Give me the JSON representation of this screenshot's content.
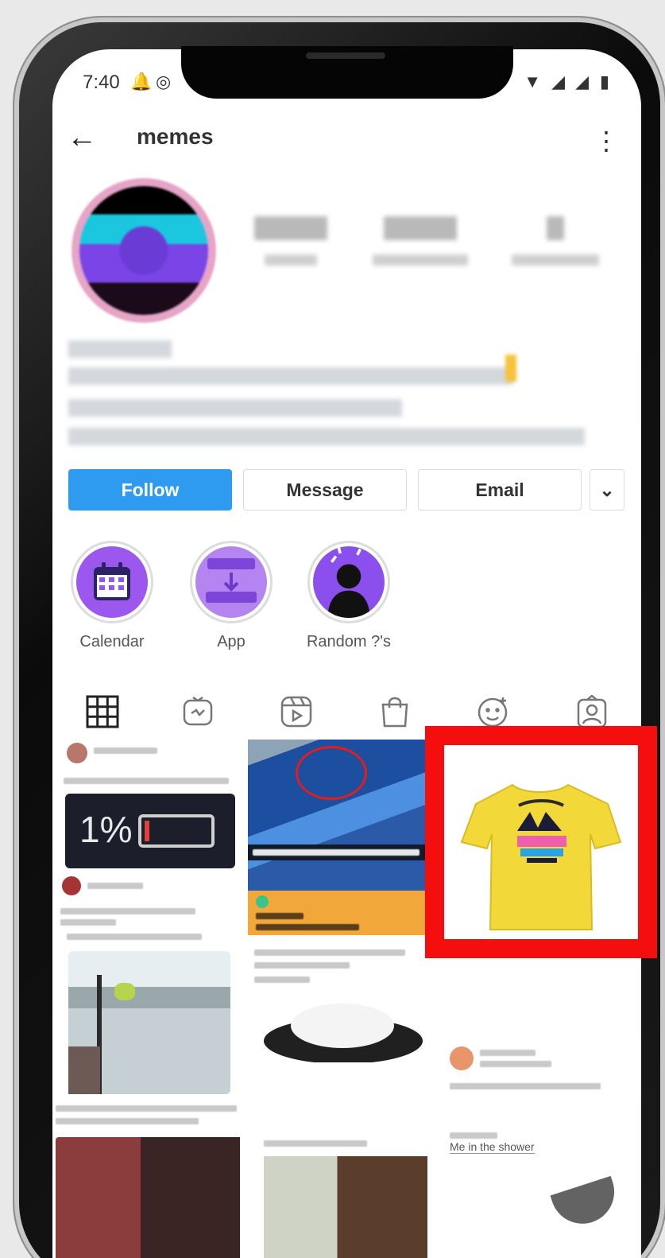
{
  "status_bar": {
    "time": "7:40"
  },
  "header": {
    "back_icon": "arrow-left-icon",
    "username": "memes",
    "menu_icon": "more-vertical-icon"
  },
  "profile_actions": {
    "follow": "Follow",
    "message": "Message",
    "email": "Email",
    "dropdown_icon": "chevron-down-icon"
  },
  "highlights": [
    {
      "label": "Calendar",
      "icon": "calendar-icon"
    },
    {
      "label": "App",
      "icon": "app-download-icon"
    },
    {
      "label": "Random ?'s",
      "icon": "person-silhouette-icon"
    }
  ],
  "tabs": [
    {
      "name": "grid",
      "icon": "grid-icon"
    },
    {
      "name": "igtv",
      "icon": "tv-icon"
    },
    {
      "name": "reels",
      "icon": "reels-icon"
    },
    {
      "name": "shop",
      "icon": "shopping-bag-icon"
    },
    {
      "name": "effects",
      "icon": "smiley-effects-icon"
    },
    {
      "name": "tagged",
      "icon": "tagged-person-icon"
    }
  ],
  "posts": {
    "battery_percent": "1%",
    "shower_caption": "Me in the shower"
  },
  "colors": {
    "follow_blue": "#2e9bf0",
    "highlight_purple": "#9c57ee",
    "annotation_red": "#f50e0e",
    "tshirt_yellow": "#f3d83a"
  }
}
